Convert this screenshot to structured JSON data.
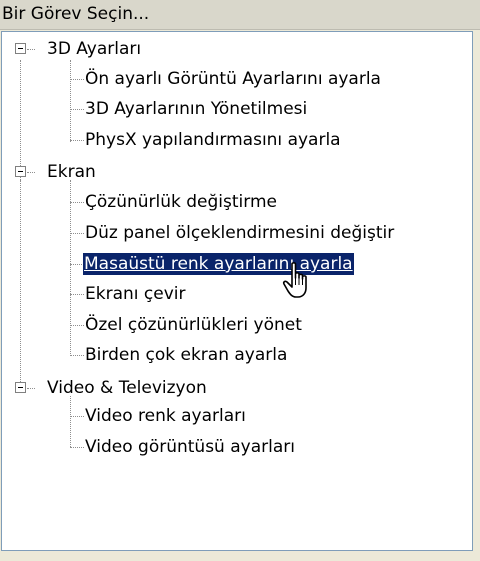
{
  "header": {
    "title": "Bir Görev Seçin..."
  },
  "tree": {
    "groups": [
      {
        "label": "3D Ayarları",
        "items": [
          "Ön ayarlı Görüntü Ayarlarını ayarla",
          "3D Ayarlarının Yönetilmesi",
          "PhysX yapılandırmasını ayarla"
        ]
      },
      {
        "label": "Ekran",
        "items": [
          "Çözünürlük değiştirme",
          "Düz panel ölçeklendirmesini değiştir",
          "Masaüstü renk ayarlarını ayarla",
          "Ekranı çevir",
          "Özel çözünürlükleri yönet",
          "Birden çok ekran ayarla"
        ]
      },
      {
        "label": "Video & Televizyon",
        "items": [
          "Video renk ayarları",
          "Video görüntüsü ayarları"
        ]
      }
    ]
  },
  "icons": {
    "expander": "minus-box-icon",
    "cursor": "hand-pointer-icon"
  },
  "colors": {
    "selection": "#0a246a",
    "panel_border": "#7f9db9"
  }
}
